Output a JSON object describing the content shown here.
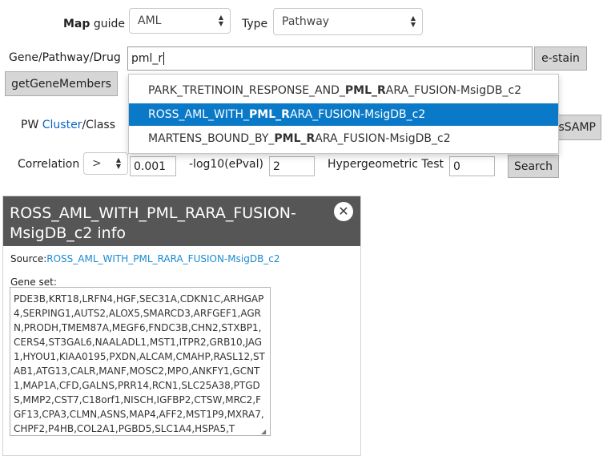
{
  "form": {
    "map_guide_label_bold": "Map",
    "map_guide_label_rest": " guide",
    "map_guide_value": "AML",
    "type_label": "Type",
    "type_value": "Pathway",
    "gene_label": "Gene/Pathway/Drug",
    "gene_value": "pml_r",
    "estain_label": "e-stain",
    "get_gene_members_label": "getGeneMembers",
    "pw_label": "PW ",
    "cluster_link": "Cluster",
    "class_label": "/Class",
    "ssamp_label": "sSAMP",
    "correlation_label": "Correlation",
    "correlation_op": ">",
    "correlation_value": "0.001",
    "log_label": "-log10(ePval)",
    "log_value": "2",
    "hyper_label": "Hypergeometric Test",
    "hyper_value": "0",
    "search_label": "Search"
  },
  "autocomplete": {
    "items": [
      {
        "pre": "PARK_TRETINOIN_RESPONSE_AND_",
        "match1": "PML_R",
        "post": "ARA_FUSION-MsigDB_c2",
        "active": false
      },
      {
        "pre": "ROSS_AML_WITH_",
        "match1": "PML_R",
        "post": "ARA_FUSION-MsigDB_c2",
        "active": true
      },
      {
        "pre": "MARTENS_BOUND_BY_",
        "match1": "PML_R",
        "post": "ARA_FUSION-MsigDB_c2",
        "active": false
      }
    ]
  },
  "info_panel": {
    "title": "ROSS_AML_WITH_PML_RARA_FUSION-MsigDB_c2 info",
    "source_label": "Source:",
    "source_link": "ROSS_AML_WITH_PML_RARA_FUSION-MsigDB_c2",
    "gene_set_label": "Gene set:",
    "gene_set_text": "PDE3B,KRT18,LRFN4,HGF,SEC31A,CDKN1C,ARHGAP4,SERPING1,AUTS2,ALOX5,SMARCD3,ARFGEF1,AGRN,PRODH,TMEM87A,MEGF6,FNDC3B,CHN2,STXBP1,CERS4,ST3GAL6,NAALADL1,MST1,ITPR2,GRB10,JAG1,HYOU1,KIAA0195,PXDN,ALCAM,CMAHP,RASL12,STAB1,ATG13,CALR,MANF,MOSC2,MPO,ANKFY1,GCNT1,MAP1A,CFD,GALNS,PRR14,RCN1,SLC25A38,PTGDS,MMP2,CST7,C18orf1,NISCH,IGFBP2,CTSW,MRC2,FGF13,CPA3,CLMN,ASNS,MAP4,AFF2,MST1P9,MXRA7,CHPF2,P4HB,COL2A1,PGBD5,SLC1A4,HSPA5,T"
  },
  "colors": {
    "link": "#0a64c8",
    "source_link": "#1a8ad0",
    "highlight": "#0a7ac8",
    "panel_header": "#565656",
    "button": "#d6d6d6"
  }
}
